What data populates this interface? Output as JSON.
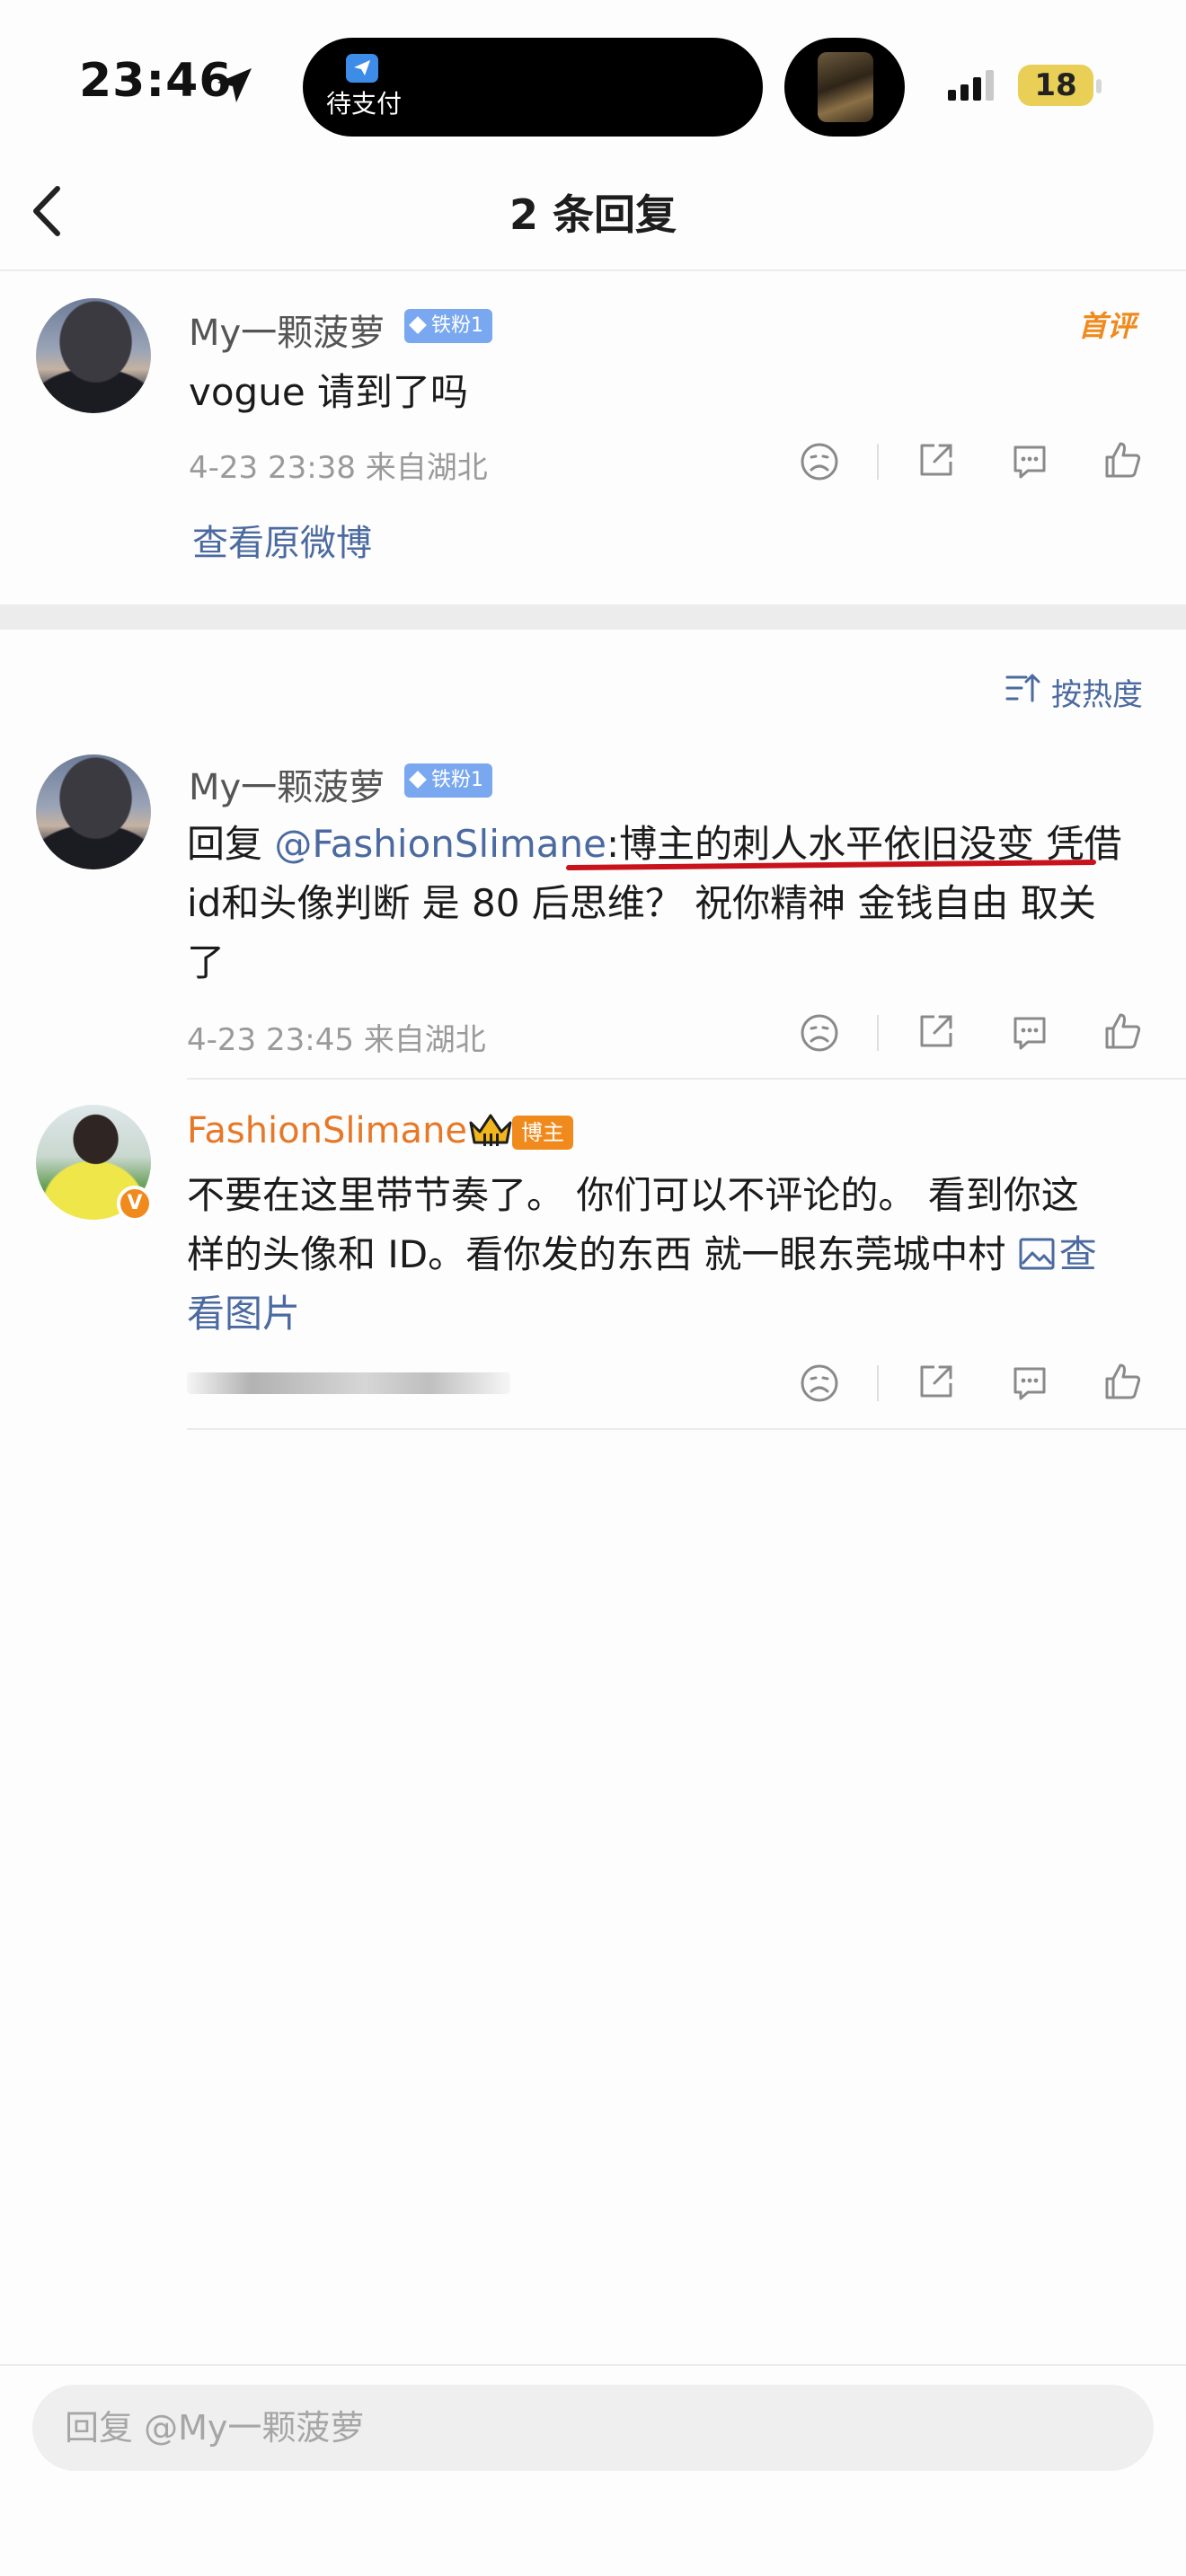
{
  "status_bar": {
    "time": "23:46",
    "live_activity_text": "待支付",
    "battery_level": "18",
    "battery_color": "#e9cf55"
  },
  "header": {
    "title": "2 条回复",
    "back_icon": "chevron-left-icon"
  },
  "original_comment": {
    "username": "My一颗菠萝",
    "fan_badge": "铁粉1",
    "first_badge": "首评",
    "text": "vogue 请到了吗",
    "meta": "4-23 23:38  来自湖北",
    "view_original": "查看原微博"
  },
  "sort": {
    "label": "按热度"
  },
  "replies": [
    {
      "username": "My一颗菠萝",
      "fan_badge": "铁粉1",
      "reply_prefix": "回复 ",
      "mention": "@FashionSlimane",
      "line1_rest": ":博主的刺人水平依旧没变 凭借",
      "line2": "id和头像判断 是 80 后思维？ 祝你精神 金钱自由 取关",
      "line3": "了",
      "meta": "4-23 23:45  来自湖北"
    },
    {
      "username": "FashionSlimane",
      "tag": "博主",
      "verified_badge": "V",
      "line1": "不要在这里带节奏了。 你们可以不评论的。 看到你这",
      "line2_text": "样的头像和 ID。看你发的东西 就一眼东莞城中村 ",
      "link_part1": "查",
      "link_part2": "看图片"
    }
  ],
  "reply_input": {
    "placeholder": "回复 @My一颗菠萝"
  },
  "colors": {
    "link_blue": "#4b6aa0",
    "accent_orange": "#f08a1c",
    "fan_badge_blue": "#7aa8f0",
    "underline_red": "#c8121c"
  }
}
